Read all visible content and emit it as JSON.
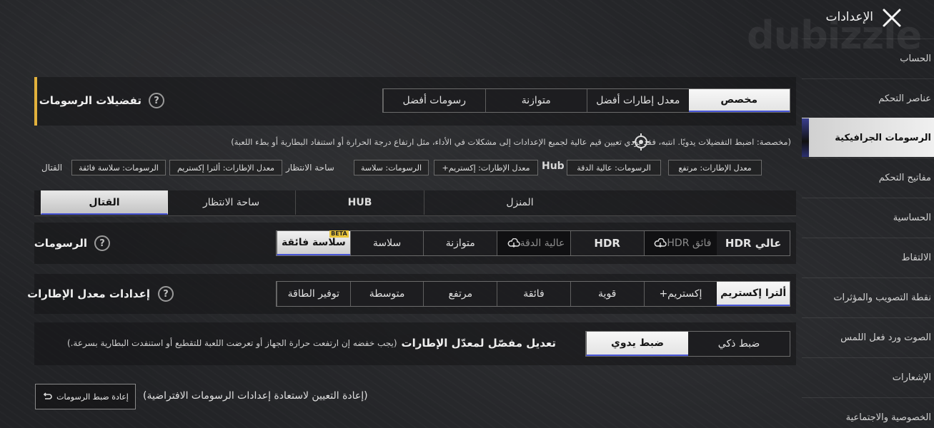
{
  "header": {
    "title": "الإعدادات",
    "watermark": "dubizzle"
  },
  "sidebar": {
    "items": [
      {
        "label": "الحساب"
      },
      {
        "label": "عناصر التحكم"
      },
      {
        "label": "الرسومات الجرافيكية"
      },
      {
        "label": "مفاتيح التحكم"
      },
      {
        "label": "الحساسية"
      },
      {
        "label": "الالتقاط"
      },
      {
        "label": "نقطة التصويب والمؤثرات"
      },
      {
        "label": "الصوت ورد فعل اللمس"
      },
      {
        "label": "الإشعارات"
      },
      {
        "label": "الخصوصية والاجتماعية"
      }
    ],
    "active_index": 2
  },
  "preferences": {
    "title": "تفضيلات الرسومات",
    "options": [
      "مخصص",
      "معدل إطارات أفضل",
      "متوازنة",
      "رسومات أفضل"
    ],
    "selected": "مخصص",
    "note": "(مخصصة: اضبط التفضيلات يدويًا. انتبه، فقد يؤدي تعيين قيم عالية لجميع الإعدادات إلى مشكلات في الأداء، مثل ارتفاع درجة الحرارة أو استنفاد البطارية أو بطء اللعبة)",
    "summary": {
      "tags": [
        "معدل الإطارات: مرتفع",
        "الرسومات: عالية الدقة",
        "Hub",
        "معدل الإطارات: إكستريم+",
        "الرسومات: سلاسة",
        "ساحة الانتظار",
        "معدل الإطارات: ألترا إكستريم",
        "الرسومات: سلاسة فائقة",
        "القتال"
      ]
    }
  },
  "location_tabs": {
    "items": [
      "المنزل",
      "HUB",
      "ساحة الانتظار",
      "القتال"
    ],
    "selected": "القتال"
  },
  "graphics": {
    "title": "الرسومات",
    "options": [
      "عالي HDR",
      "فائق HDR",
      "HDR",
      "عالية الدقة",
      "متوازنة",
      "سلاسة",
      "سلاسة فائقة"
    ],
    "selected": "سلاسة فائقة",
    "beta_label": "BETA"
  },
  "frame_rate": {
    "title": "إعدادات معدل الإطارات",
    "options": [
      "ألترا إكستريم",
      "إكستريم+",
      "قوية",
      "فائقة",
      "مرتفع",
      "متوسطة",
      "توفير الطاقة"
    ],
    "selected": "ألترا إكستريم"
  },
  "detailed_fps": {
    "title": "تعديل مفصّل لمعدّل الإطارات",
    "note": "(يجب خفضه إن ارتفعت حرارة الجهاز أو تعرضت اللعبة للتقطيع أو استنفدت البطارية بسرعة.)",
    "options": [
      "ضبط ذكي",
      "ضبط يدوي"
    ],
    "selected": "ضبط يدوي"
  },
  "reset": {
    "description": "(إعادة التعيين لاستعادة إعدادات الرسومات الافتراضية)",
    "button_label": "إعادة ضبط الرسومات"
  },
  "colors": {
    "accent_blue": "#4855d6",
    "accent_gold": "#e2b13c"
  }
}
